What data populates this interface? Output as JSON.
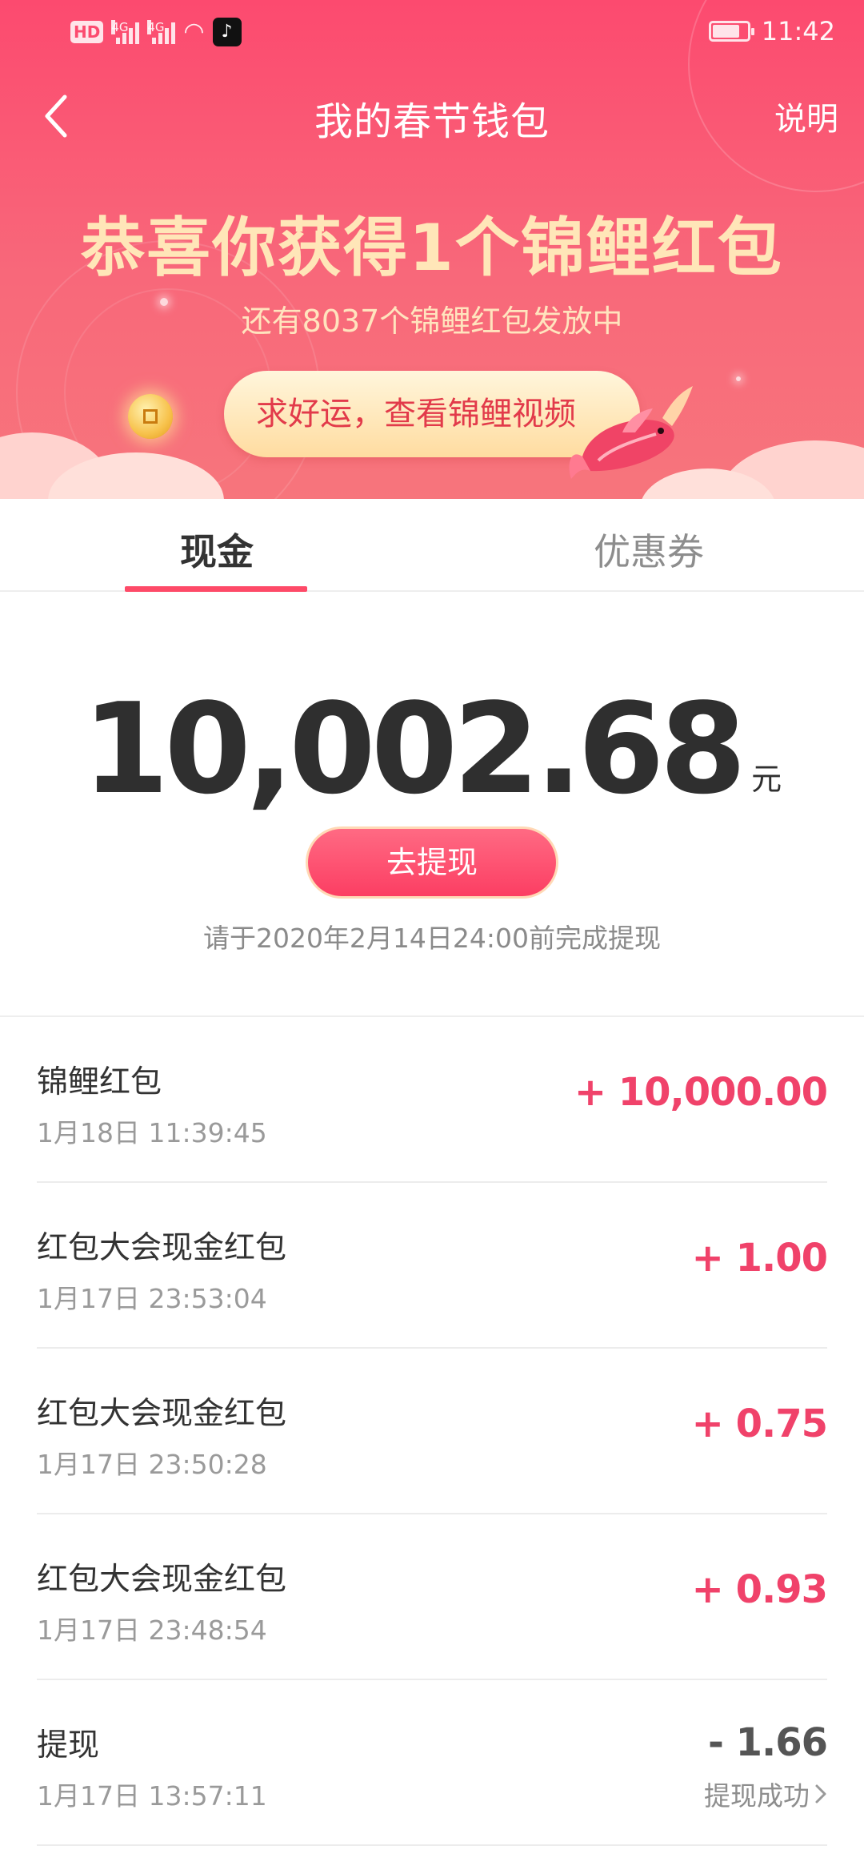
{
  "status_bar": {
    "time": "11:42",
    "network_label_1": "4G",
    "network_label_2": "4G",
    "hd_label": "HD",
    "app_notification_icon": "tiktok-icon",
    "battery_level": 0.8
  },
  "nav": {
    "title": "我的春节钱包",
    "help_label": "说明",
    "back_icon": "chevron-left-icon"
  },
  "banner": {
    "headline": "恭喜你获得1个锦鲤红包",
    "remaining": "还有8037个锦鲤红包发放中",
    "cta_label": "求好运，查看锦鲤视频"
  },
  "tabs": [
    {
      "label": "现金",
      "active": true
    },
    {
      "label": "优惠券",
      "active": false
    }
  ],
  "balance": {
    "amount": "10,002.68",
    "unit": "元",
    "withdraw_label": "去提现",
    "deadline_note": "请于2020年2月14日24:00前完成提现"
  },
  "transactions": [
    {
      "title": "锦鲤红包",
      "time": "1月18日 11:39:45",
      "amount": "+ 10,000.00"
    },
    {
      "title": "红包大会现金红包",
      "time": "1月17日 23:53:04",
      "amount": "+ 1.00"
    },
    {
      "title": "红包大会现金红包",
      "time": "1月17日 23:50:28",
      "amount": "+ 0.75"
    },
    {
      "title": "红包大会现金红包",
      "time": "1月17日 23:48:54",
      "amount": "+ 0.93"
    },
    {
      "title": "提现",
      "time": "1月17日 13:57:11",
      "amount": "- 1.66",
      "status": "提现成功"
    }
  ],
  "colors": {
    "brand": "#fc4a6f",
    "income": "#f0426a",
    "headline": "#ffe6b8",
    "tab_indicator": "#fe4a68"
  }
}
